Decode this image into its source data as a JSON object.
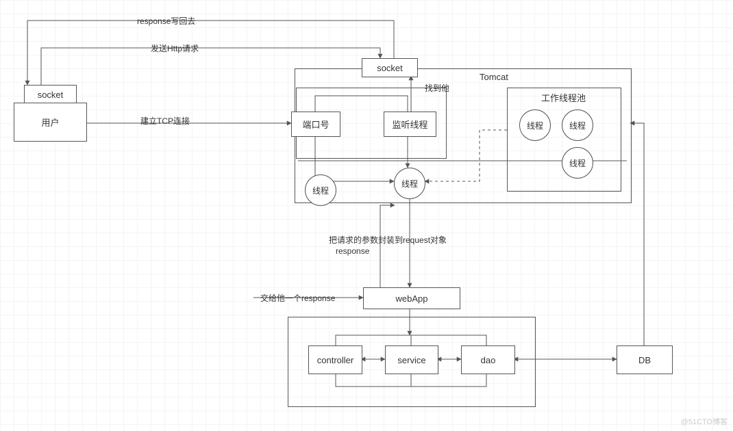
{
  "nodes": {
    "user_socket": "socket",
    "user": "用户",
    "tcp_label": "建立TCP连接",
    "send_http_label": "发送Http请求",
    "response_back_label": "response写回去",
    "port": "端口号",
    "listener": "监听线程",
    "top_socket": "socket",
    "tomcat_title": "Tomcat",
    "find_label": "找到他",
    "threadpool_title": "工作线程池",
    "pool_t1": "线程",
    "pool_t2": "线程",
    "pool_t3": "线程",
    "outside_thread_left": "线程",
    "center_thread": "线程",
    "encapsulate_label": "把请求的参数封装到request对象",
    "response_label": "response",
    "give_response_label": "交给他一个response",
    "webapp": "webApp",
    "controller": "controller",
    "service": "service",
    "dao": "dao",
    "db": "DB",
    "watermark": "@51CTO博客"
  }
}
